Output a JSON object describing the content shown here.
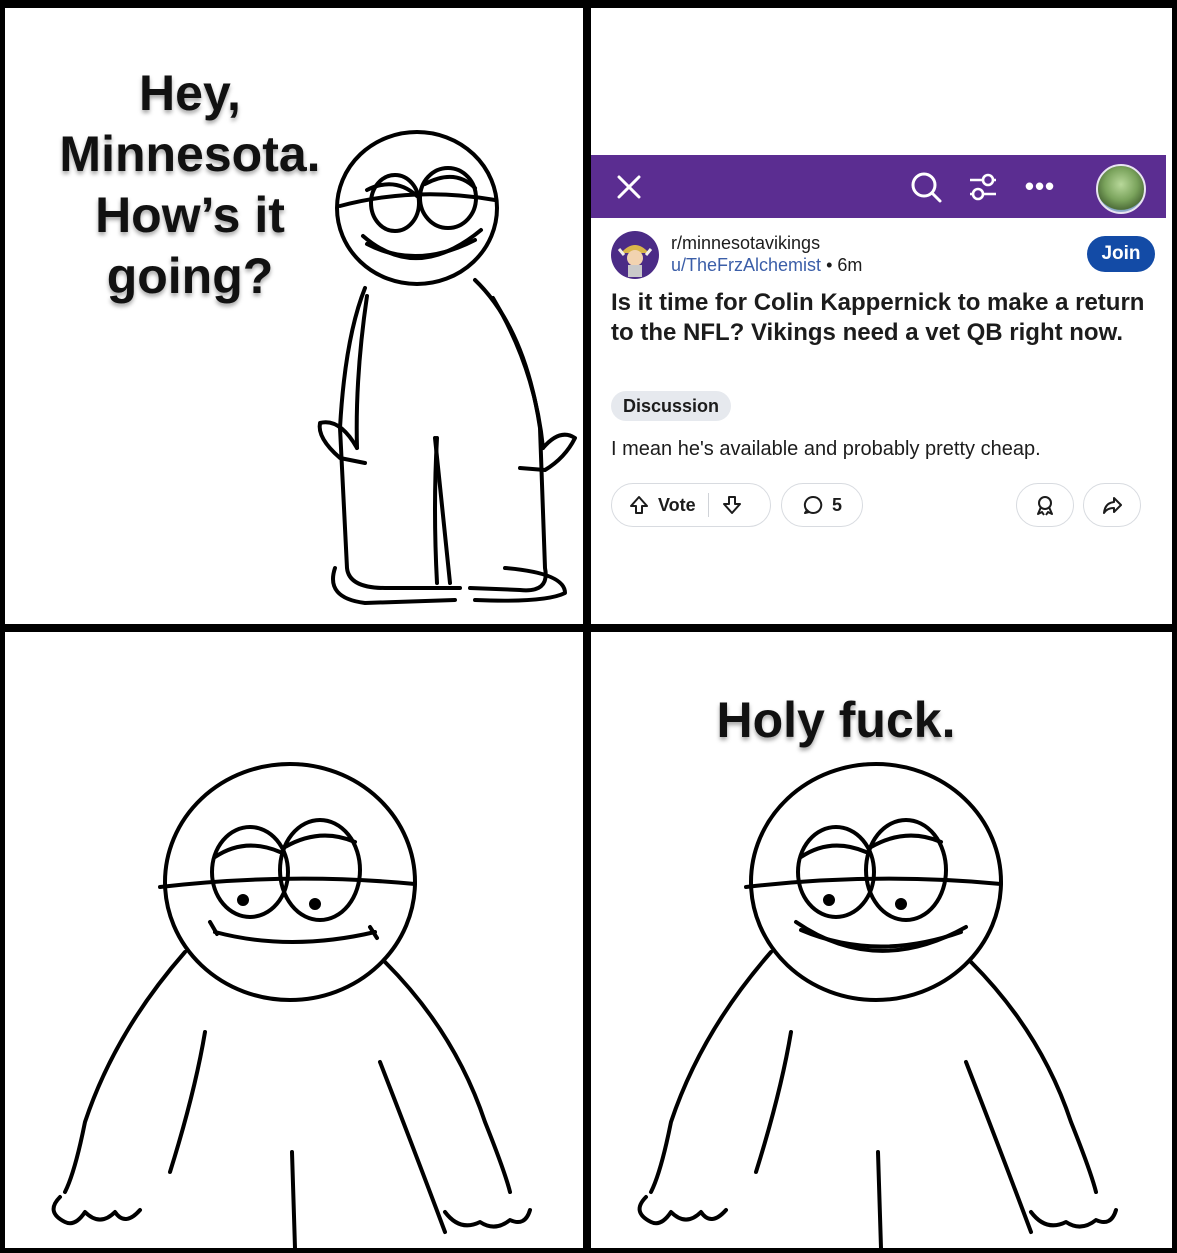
{
  "panels": {
    "top_left": {
      "caption": "Hey, Minnesota. How’s it going?"
    },
    "bottom_right": {
      "caption": "Holy fuck."
    }
  },
  "reddit_post": {
    "subreddit": "r/minnesotavikings",
    "username": "u/TheFrzAlchemist",
    "separator": "•",
    "time": "6m",
    "join_label": "Join",
    "title": "Is it time for Colin Kappernick to make a return to the NFL? Vikings need a vet QB right now.",
    "flair": "Discussion",
    "body": "I mean he's available and probably pretty cheap.",
    "vote_label": "Vote",
    "comment_count": "5",
    "header_color": "#5b2d91",
    "join_color": "#134ba6"
  }
}
